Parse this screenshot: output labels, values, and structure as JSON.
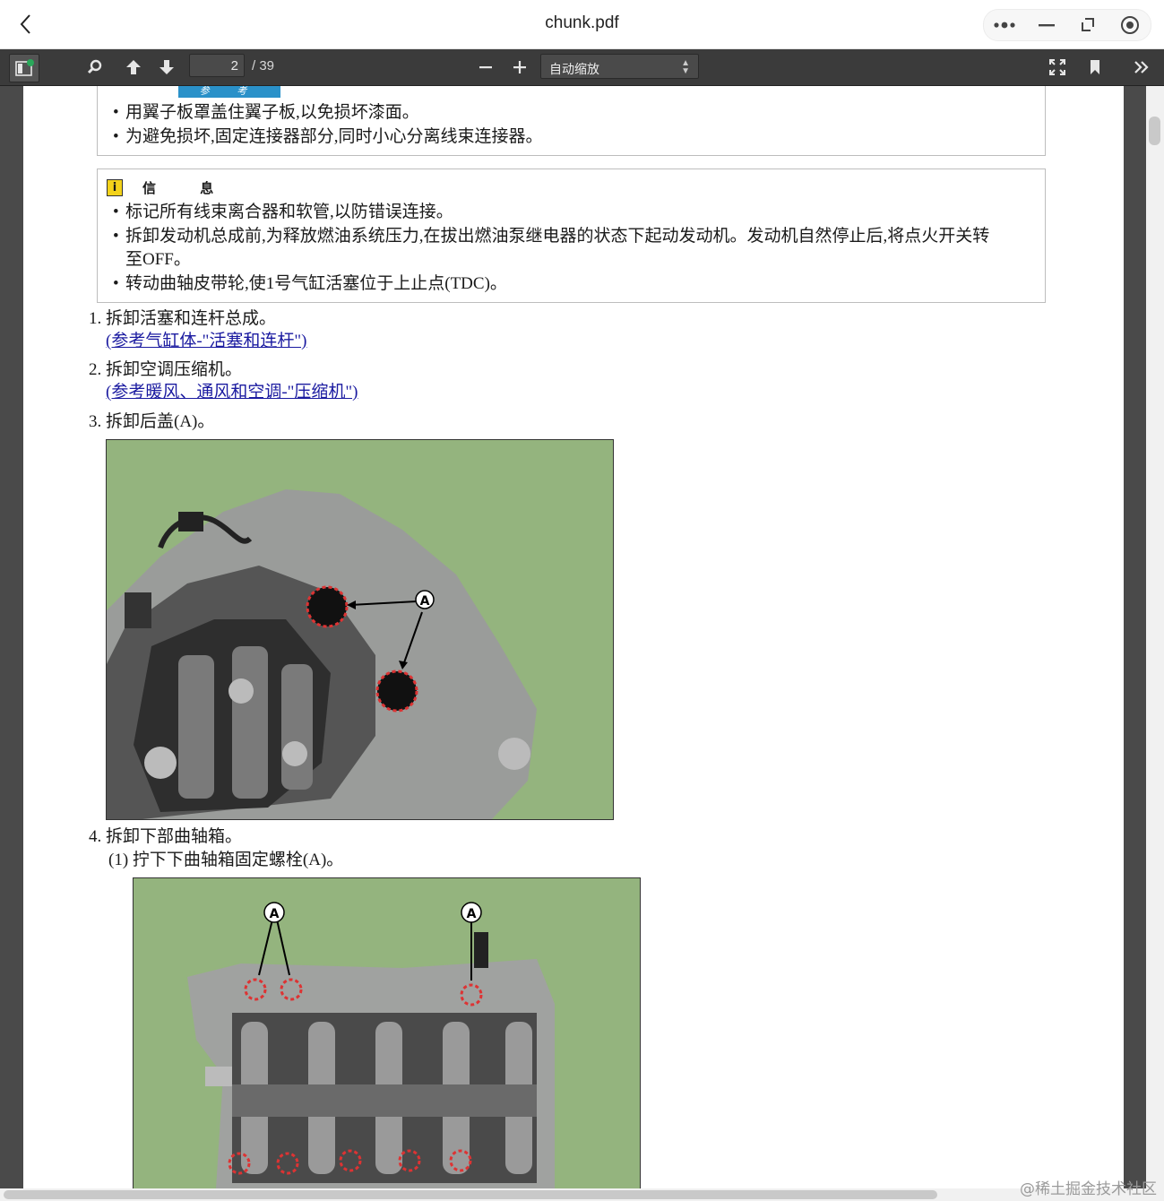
{
  "window": {
    "title": "chunk.pdf",
    "back_icon": "chevron-left-icon",
    "controls": [
      "more-icon",
      "minimize-icon",
      "restore-icon",
      "close-circle-icon"
    ]
  },
  "toolbar": {
    "current_page": "2",
    "page_count": "/ 39",
    "zoom_label": "自动缩放",
    "accent_color": "#2aa85a"
  },
  "content": {
    "note_box": {
      "tag": "参 考",
      "bullets": [
        "用翼子板罩盖住翼子板,以免损坏漆面。",
        "为避免损坏,固定连接器部分,同时小心分离线束连接器。"
      ]
    },
    "info_box": {
      "title": "信 息",
      "bullets": [
        "标记所有线束离合器和软管,以防错误连接。",
        "拆卸发动机总成前,为释放燃油系统压力,在拔出燃油泵继电器的状态下起动发动机。发动机自然停止后,将点火开关转",
        "至OFF。",
        "转动曲轴皮带轮,使1号气缸活塞位于上止点(TDC)。"
      ]
    },
    "steps": [
      {
        "text": "1. 拆卸活塞和连杆总成。",
        "link": "(参考气缸体-\"活塞和连杆\")"
      },
      {
        "text": "2. 拆卸空调压缩机。",
        "link": "(参考暖风、通风和空调-\"压缩机\")"
      },
      {
        "text": "3. 拆卸后盖(A)。"
      },
      {
        "text": "4. 拆卸下部曲轴箱。",
        "sub": "(1) 拧下下曲轴箱固定螺栓(A)。"
      }
    ],
    "figure1": {
      "callout": "A"
    },
    "figure2": {
      "callout_left": "A",
      "callout_right": "A"
    }
  },
  "watermark": "@稀土掘金技术社区"
}
